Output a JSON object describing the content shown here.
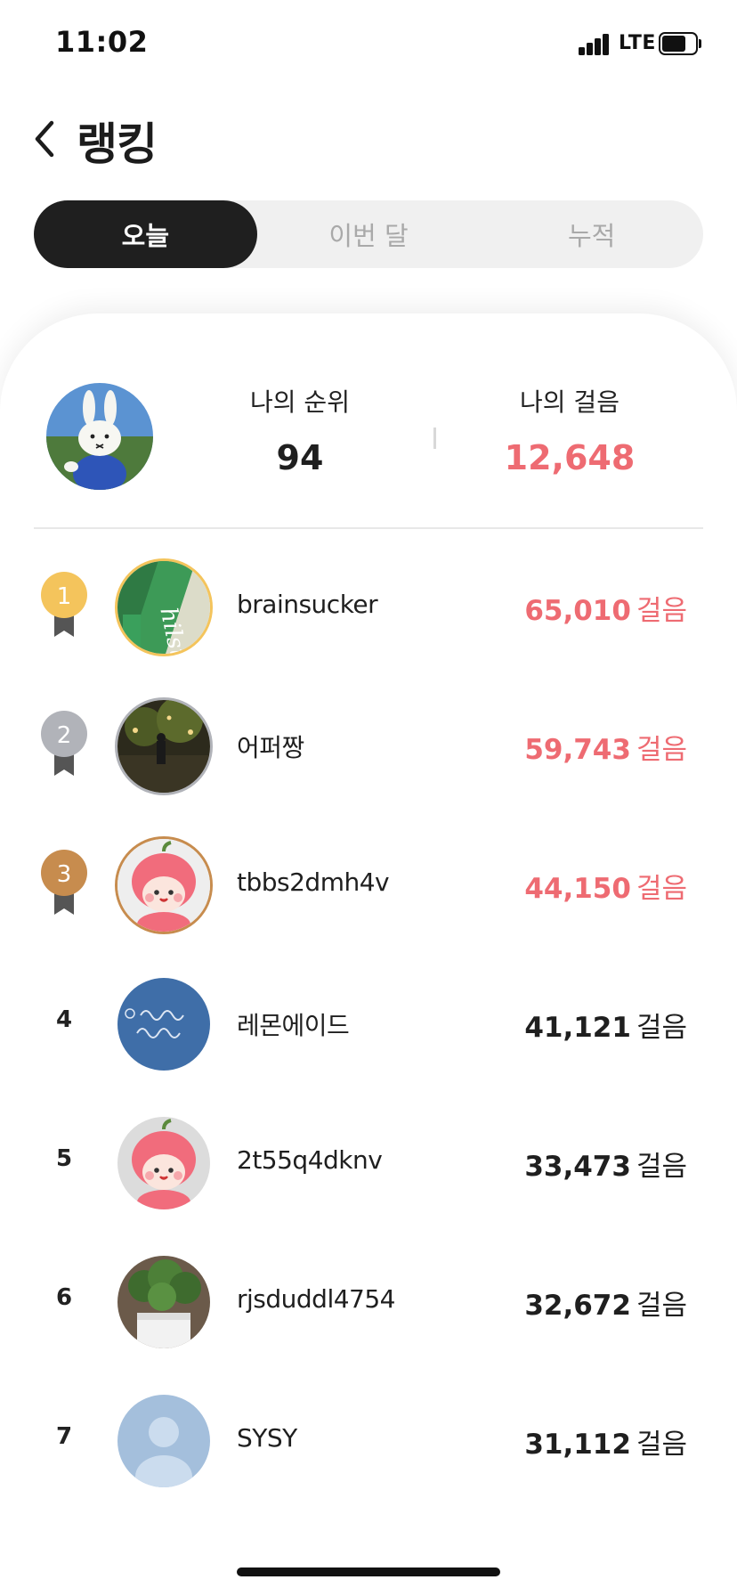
{
  "status_bar": {
    "time": "11:02",
    "network": "LTE"
  },
  "header": {
    "title": "랭킹"
  },
  "tabs": [
    {
      "label": "오늘",
      "active": true
    },
    {
      "label": "이번 달",
      "active": false
    },
    {
      "label": "누적",
      "active": false
    }
  ],
  "my_summary": {
    "rank_label": "나의 순위",
    "rank_value": "94",
    "steps_label": "나의 걸음",
    "steps_value": "12,648"
  },
  "ranking": [
    {
      "rank": "1",
      "name": "brainsucker",
      "steps": "65,010",
      "unit": "걸음",
      "medal": "gold"
    },
    {
      "rank": "2",
      "name": "어퍼짱",
      "steps": "59,743",
      "unit": "걸음",
      "medal": "silver"
    },
    {
      "rank": "3",
      "name": "tbbs2dmh4v",
      "steps": "44,150",
      "unit": "걸음",
      "medal": "bronze"
    },
    {
      "rank": "4",
      "name": "레몬에이드",
      "steps": "41,121",
      "unit": "걸음",
      "medal": null
    },
    {
      "rank": "5",
      "name": "2t55q4dknv",
      "steps": "33,473",
      "unit": "걸음",
      "medal": null
    },
    {
      "rank": "6",
      "name": "rjsduddl4754",
      "steps": "32,672",
      "unit": "걸음",
      "medal": null
    },
    {
      "rank": "7",
      "name": "SYSY",
      "steps": "31,112",
      "unit": "걸음",
      "medal": null
    }
  ],
  "colors": {
    "accent": "#ee6b72",
    "gold": "#f4c45c",
    "silver": "#b1b3b9",
    "bronze": "#c78c4e",
    "tab_active_bg": "#1f1f1f"
  },
  "icons": {
    "back": "chevron-left-icon",
    "medal": "medal-ribbon-icon",
    "default_avatar": "user-silhouette-icon"
  }
}
